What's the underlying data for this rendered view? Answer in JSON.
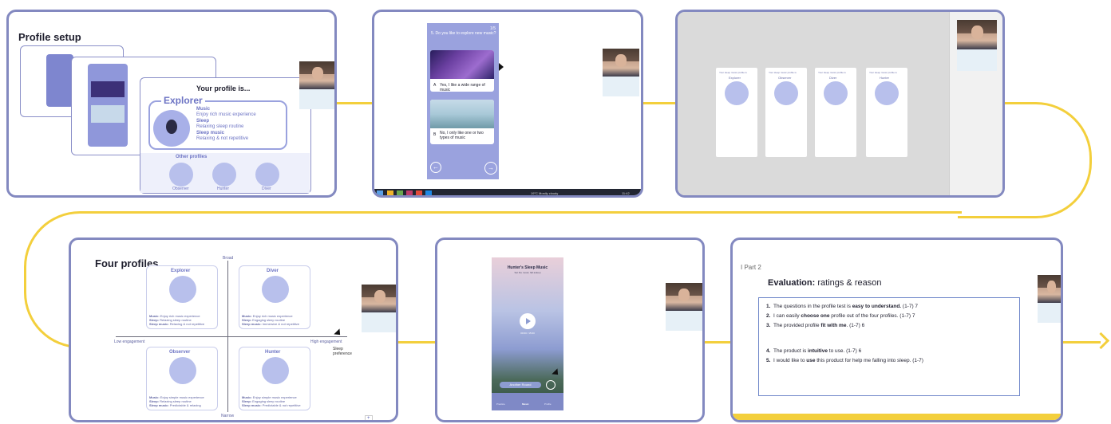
{
  "colors": {
    "panel_border": "#8389c0",
    "connector": "#f3cf3c",
    "app_purple": "#9aa2de",
    "accent": "#5b63b7"
  },
  "panel1": {
    "title": "Profile setup",
    "profile_heading": "Your profile is...",
    "main_profile": "Explorer",
    "music_label": "Music",
    "music_text": "Enjoy rich music experience",
    "sleep_label": "Sleep",
    "sleep_text": "Relaxing sleep routine",
    "sleep_music_label": "Sleep music",
    "sleep_music_text": "Relaxing & not repetitive",
    "other_profiles_label": "Other profiles",
    "other_profiles": [
      "Observer",
      "Hunter",
      "Diver"
    ]
  },
  "panel2": {
    "counter": "1/5",
    "question": "5. Do you like to explore new music?",
    "option_a_key": "A",
    "option_a": "Yes, I like a wide range of music",
    "option_b_key": "B",
    "option_b": "No, I only like one or two types of music",
    "taskbar_weather": "19°C  Mostly cloudy",
    "taskbar_time": "11:42"
  },
  "panel3": {
    "cards": [
      {
        "heading": "Your sleep music profile is",
        "name": "Explorer"
      },
      {
        "heading": "Your sleep music profile is",
        "name": "Observer"
      },
      {
        "heading": "Your sleep music profile is",
        "name": "Diver"
      },
      {
        "heading": "Your sleep music profile is",
        "name": "Hunter"
      }
    ]
  },
  "panel4": {
    "title": "Four profiles",
    "axis_top": "Broad",
    "axis_bottom": "Narrow",
    "axis_left": "Low engagement",
    "axis_right": "High engagement",
    "axis_note": "Sleep preference",
    "quadrants": [
      {
        "name": "Explorer",
        "lines": [
          [
            "Music: ",
            "Enjoy rich music experience"
          ],
          [
            "Sleep: ",
            "Relaxing sleep routine"
          ],
          [
            "Sleep music: ",
            "Relaxing & not repetitive"
          ]
        ]
      },
      {
        "name": "Diver",
        "lines": [
          [
            "Music: ",
            "Enjoy rich music experience"
          ],
          [
            "Sleep: ",
            "Engaging sleep routine"
          ],
          [
            "Sleep music: ",
            "Immersive & not repetitive"
          ]
        ]
      },
      {
        "name": "Observer",
        "lines": [
          [
            "Music: ",
            "Enjoy simple music experience"
          ],
          [
            "Sleep: ",
            "Relaxing sleep routine"
          ],
          [
            "Sleep music: ",
            "Predictable & relaxing"
          ]
        ]
      },
      {
        "name": "Hunter",
        "lines": [
          [
            "Music: ",
            "Enjoy simple music experience"
          ],
          [
            "Sleep: ",
            "Engaging sleep routine"
          ],
          [
            "Sleep music: ",
            "Predictable & not repetitive"
          ]
        ]
      }
    ],
    "page_indicator": "+"
  },
  "panel5": {
    "app_title": "Hunter's Sleep Music",
    "app_subtitle": "Set the mood, fall asleep",
    "timer": "00:00 / 15:00",
    "button_label": "Another Round",
    "nav": [
      "Practice",
      "Music",
      "Profile"
    ]
  },
  "panel6": {
    "part": "I Part 2",
    "heading_bold": "Evaluation:",
    "heading_rest": " ratings & reason",
    "items": [
      {
        "num": "1.",
        "pre": "The questions in the profile test is ",
        "bold": "easy to understand.",
        "post": " (1-7)  7"
      },
      {
        "num": "2.",
        "pre": "I can easily ",
        "bold": "choose one",
        "post": " profile out of the four profiles. (1-7)   7"
      },
      {
        "num": "3.",
        "pre": "The provided profile ",
        "bold": "fit with me",
        "post": ". (1-7) 6"
      },
      {
        "num": "4.",
        "pre": "The product is ",
        "bold": "intuitive",
        "post": " to use.  (1-7)  6"
      },
      {
        "num": "5.",
        "pre": "I would like to ",
        "bold": "use",
        "post": " this product for help me falling into sleep. (1-7)"
      }
    ]
  }
}
